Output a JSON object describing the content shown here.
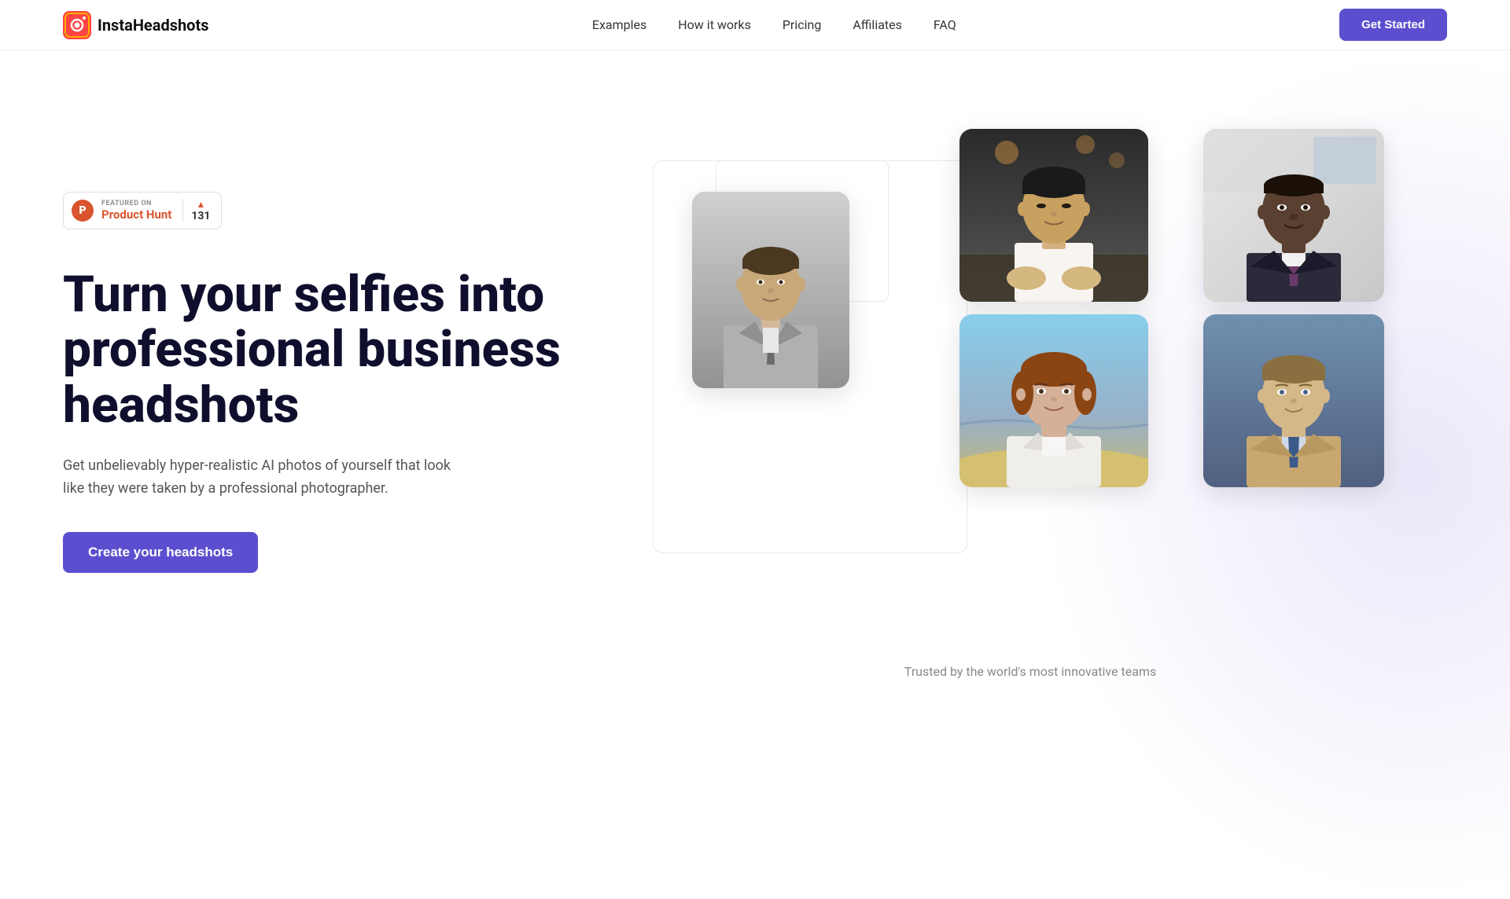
{
  "nav": {
    "logo_first": "Insta",
    "logo_second": "Headshots",
    "links": [
      {
        "label": "Examples",
        "id": "examples"
      },
      {
        "label": "How it works",
        "id": "how-it-works"
      },
      {
        "label": "Pricing",
        "id": "pricing"
      },
      {
        "label": "Affiliates",
        "id": "affiliates"
      },
      {
        "label": "FAQ",
        "id": "faq"
      }
    ],
    "cta_label": "Get Started"
  },
  "product_hunt": {
    "featured_text": "FEATURED ON",
    "name": "Product Hunt",
    "count": "131",
    "logo_letter": "P"
  },
  "hero": {
    "title_line1": "Turn your selfies into",
    "title_line2": "professional business",
    "title_line3": "headshots",
    "subtitle": "Get unbelievably hyper-realistic AI photos of yourself that look like they were taken by a professional photographer.",
    "cta_label": "Create your headshots"
  },
  "trusted": {
    "text": "Trusted by the world's most innovative teams"
  },
  "colors": {
    "accent": "#5b4fcf",
    "ph_orange": "#da552f",
    "text_dark": "#0f0f2d",
    "text_muted": "#555555"
  },
  "photos": {
    "center": {
      "desc": "Middle-aged man in gray suit",
      "type": "man-gray-suit"
    },
    "col1_top": {
      "desc": "Asian man in white shirt",
      "type": "asian-man"
    },
    "col1_bottom": {
      "desc": "Woman with auburn hair",
      "type": "woman-auburn"
    },
    "col2_top": {
      "desc": "Black man in dark suit",
      "type": "black-man-suit"
    },
    "col2_bottom": {
      "desc": "Young man in tan blazer",
      "type": "young-man-blazer"
    }
  }
}
